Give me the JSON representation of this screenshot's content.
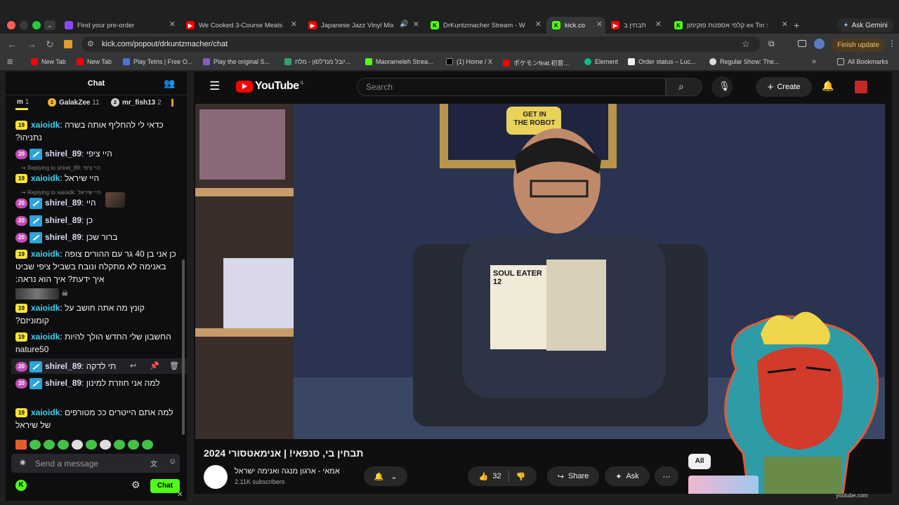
{
  "browser": {
    "tabs": [
      {
        "title": "Find your pre-order",
        "icon": "twitch-icon"
      },
      {
        "title": "We Cooked 3-Course Meals",
        "icon": "youtube-icon"
      },
      {
        "title": "Japanese Jazz Vinyl Mix",
        "icon": "youtube-icon"
      },
      {
        "title": "DrKuntzmacher Stream - W",
        "icon": "kick-icon"
      },
      {
        "title": "kick.co",
        "icon": "kick-icon"
      },
      {
        "title": "תבחין ב",
        "icon": "youtube-icon"
      },
      {
        "title": "קלפי אספנות פוקימון ex Tin :",
        "icon": "kick-icon"
      }
    ],
    "ask_gemini": "Ask Gemini",
    "url": "kick.com/popout/drkuntzmacher/chat",
    "finish_update": "Finish update",
    "bookmarks": [
      "New Tab",
      "New Tab",
      "Play Tetris | Free O...",
      "Play the original S...",
      "יובל מנדלסון - מלח...",
      "Maorameleh Strea...",
      "(1) Home / X",
      "ポケモンfeat.初音...",
      "Element",
      "Order status – Luc...",
      "Regular Show: The..."
    ],
    "all_bookmarks": "All Bookmarks"
  },
  "chat": {
    "title": "Chat",
    "leaderboard": [
      {
        "name": "m",
        "count": "1"
      },
      {
        "name": "GalakZee",
        "count": "11"
      },
      {
        "name": "mr_fish13",
        "count": "2"
      }
    ],
    "messages": [
      {
        "badge": "19",
        "user": "xaioidk",
        "text": "כדאי לי להחליף אותה בשרה נתניהו?",
        "sep": ": "
      },
      {
        "badge": "20",
        "user": "shirel_89",
        "text": "היי ציפי",
        "sep": ": "
      },
      {
        "reply": "Replying to shirel_89: היי ציפי"
      },
      {
        "badge": "19",
        "user": "xaioidk",
        "text": "היי שיראל",
        "sep": ": "
      },
      {
        "reply": "Replying to xaioidk: היי שיראל"
      },
      {
        "badge": "20",
        "user": "shirel_89",
        "text": "היי",
        "sep": ": "
      },
      {
        "badge": "20",
        "user": "shirel_89",
        "text": "כן",
        "sep": ": "
      },
      {
        "badge": "20",
        "user": "shirel_89",
        "text": "ברור שכן",
        "sep": ": "
      },
      {
        "badge": "19",
        "user": "xaioidk",
        "text": "כן אני בן 40 גר עם ההורים צופה באנימה לא מתקלח ונובח בשביל ציפי שביט איך ידעת? איך הוא נראה:",
        "sep": ": "
      },
      {
        "badge": "19",
        "user": "xaioidk",
        "text": "קונץ מה אתה חושב על קומוניזם?",
        "sep": ": "
      },
      {
        "badge": "19",
        "user": "xaioidk",
        "text": "החשבון שלי החדש הולך להיות nature50",
        "sep": ": "
      },
      {
        "badge": "20",
        "user": "shirel_89",
        "text": "תי לדקה",
        "sep": ": "
      },
      {
        "badge": "20",
        "user": "shirel_89",
        "text": "למה אני חוזרת למינון",
        "sep": ": "
      },
      {
        "badge": "19",
        "user": "xaioidk",
        "text": "למה אתם הייטרים ככ מטורפים של שיראל",
        "sep": ": "
      }
    ],
    "send_placeholder": "Send a message",
    "chat_button": "Chat"
  },
  "youtube": {
    "logo": "YouTube",
    "country": "IL",
    "search_placeholder": "Search",
    "create": "Create",
    "video_title": "תבחין בי, סנפאי! | אנימאטסורי 2024",
    "sign_top": "GET IN",
    "sign_bottom": "THE ROBOT",
    "manga_title": "SOUL EATER",
    "manga_volume": "12",
    "channel_name": "אמאי - ארגון מנגה ואנימה ישראל",
    "subscribers": "2.11K subscribers",
    "likes": "32",
    "share": "Share",
    "ask": "Ask",
    "all_chip": "All",
    "footer_url": "youtube.com"
  },
  "colors": {
    "kick_green": "#53fc18",
    "youtube_red": "#ff0000",
    "badge_yellow": "#f9e33a",
    "badge_pink": "#c24ab5"
  }
}
